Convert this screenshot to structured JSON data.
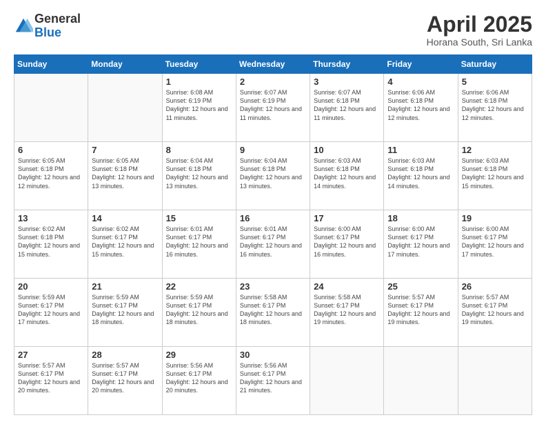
{
  "header": {
    "logo_general": "General",
    "logo_blue": "Blue",
    "month_title": "April 2025",
    "location": "Horana South, Sri Lanka"
  },
  "weekdays": [
    "Sunday",
    "Monday",
    "Tuesday",
    "Wednesday",
    "Thursday",
    "Friday",
    "Saturday"
  ],
  "weeks": [
    [
      {
        "day": "",
        "info": ""
      },
      {
        "day": "",
        "info": ""
      },
      {
        "day": "1",
        "info": "Sunrise: 6:08 AM\nSunset: 6:19 PM\nDaylight: 12 hours and 11 minutes."
      },
      {
        "day": "2",
        "info": "Sunrise: 6:07 AM\nSunset: 6:19 PM\nDaylight: 12 hours and 11 minutes."
      },
      {
        "day": "3",
        "info": "Sunrise: 6:07 AM\nSunset: 6:18 PM\nDaylight: 12 hours and 11 minutes."
      },
      {
        "day": "4",
        "info": "Sunrise: 6:06 AM\nSunset: 6:18 PM\nDaylight: 12 hours and 12 minutes."
      },
      {
        "day": "5",
        "info": "Sunrise: 6:06 AM\nSunset: 6:18 PM\nDaylight: 12 hours and 12 minutes."
      }
    ],
    [
      {
        "day": "6",
        "info": "Sunrise: 6:05 AM\nSunset: 6:18 PM\nDaylight: 12 hours and 12 minutes."
      },
      {
        "day": "7",
        "info": "Sunrise: 6:05 AM\nSunset: 6:18 PM\nDaylight: 12 hours and 13 minutes."
      },
      {
        "day": "8",
        "info": "Sunrise: 6:04 AM\nSunset: 6:18 PM\nDaylight: 12 hours and 13 minutes."
      },
      {
        "day": "9",
        "info": "Sunrise: 6:04 AM\nSunset: 6:18 PM\nDaylight: 12 hours and 13 minutes."
      },
      {
        "day": "10",
        "info": "Sunrise: 6:03 AM\nSunset: 6:18 PM\nDaylight: 12 hours and 14 minutes."
      },
      {
        "day": "11",
        "info": "Sunrise: 6:03 AM\nSunset: 6:18 PM\nDaylight: 12 hours and 14 minutes."
      },
      {
        "day": "12",
        "info": "Sunrise: 6:03 AM\nSunset: 6:18 PM\nDaylight: 12 hours and 15 minutes."
      }
    ],
    [
      {
        "day": "13",
        "info": "Sunrise: 6:02 AM\nSunset: 6:18 PM\nDaylight: 12 hours and 15 minutes."
      },
      {
        "day": "14",
        "info": "Sunrise: 6:02 AM\nSunset: 6:17 PM\nDaylight: 12 hours and 15 minutes."
      },
      {
        "day": "15",
        "info": "Sunrise: 6:01 AM\nSunset: 6:17 PM\nDaylight: 12 hours and 16 minutes."
      },
      {
        "day": "16",
        "info": "Sunrise: 6:01 AM\nSunset: 6:17 PM\nDaylight: 12 hours and 16 minutes."
      },
      {
        "day": "17",
        "info": "Sunrise: 6:00 AM\nSunset: 6:17 PM\nDaylight: 12 hours and 16 minutes."
      },
      {
        "day": "18",
        "info": "Sunrise: 6:00 AM\nSunset: 6:17 PM\nDaylight: 12 hours and 17 minutes."
      },
      {
        "day": "19",
        "info": "Sunrise: 6:00 AM\nSunset: 6:17 PM\nDaylight: 12 hours and 17 minutes."
      }
    ],
    [
      {
        "day": "20",
        "info": "Sunrise: 5:59 AM\nSunset: 6:17 PM\nDaylight: 12 hours and 17 minutes."
      },
      {
        "day": "21",
        "info": "Sunrise: 5:59 AM\nSunset: 6:17 PM\nDaylight: 12 hours and 18 minutes."
      },
      {
        "day": "22",
        "info": "Sunrise: 5:59 AM\nSunset: 6:17 PM\nDaylight: 12 hours and 18 minutes."
      },
      {
        "day": "23",
        "info": "Sunrise: 5:58 AM\nSunset: 6:17 PM\nDaylight: 12 hours and 18 minutes."
      },
      {
        "day": "24",
        "info": "Sunrise: 5:58 AM\nSunset: 6:17 PM\nDaylight: 12 hours and 19 minutes."
      },
      {
        "day": "25",
        "info": "Sunrise: 5:57 AM\nSunset: 6:17 PM\nDaylight: 12 hours and 19 minutes."
      },
      {
        "day": "26",
        "info": "Sunrise: 5:57 AM\nSunset: 6:17 PM\nDaylight: 12 hours and 19 minutes."
      }
    ],
    [
      {
        "day": "27",
        "info": "Sunrise: 5:57 AM\nSunset: 6:17 PM\nDaylight: 12 hours and 20 minutes."
      },
      {
        "day": "28",
        "info": "Sunrise: 5:57 AM\nSunset: 6:17 PM\nDaylight: 12 hours and 20 minutes."
      },
      {
        "day": "29",
        "info": "Sunrise: 5:56 AM\nSunset: 6:17 PM\nDaylight: 12 hours and 20 minutes."
      },
      {
        "day": "30",
        "info": "Sunrise: 5:56 AM\nSunset: 6:17 PM\nDaylight: 12 hours and 21 minutes."
      },
      {
        "day": "",
        "info": ""
      },
      {
        "day": "",
        "info": ""
      },
      {
        "day": "",
        "info": ""
      }
    ]
  ]
}
